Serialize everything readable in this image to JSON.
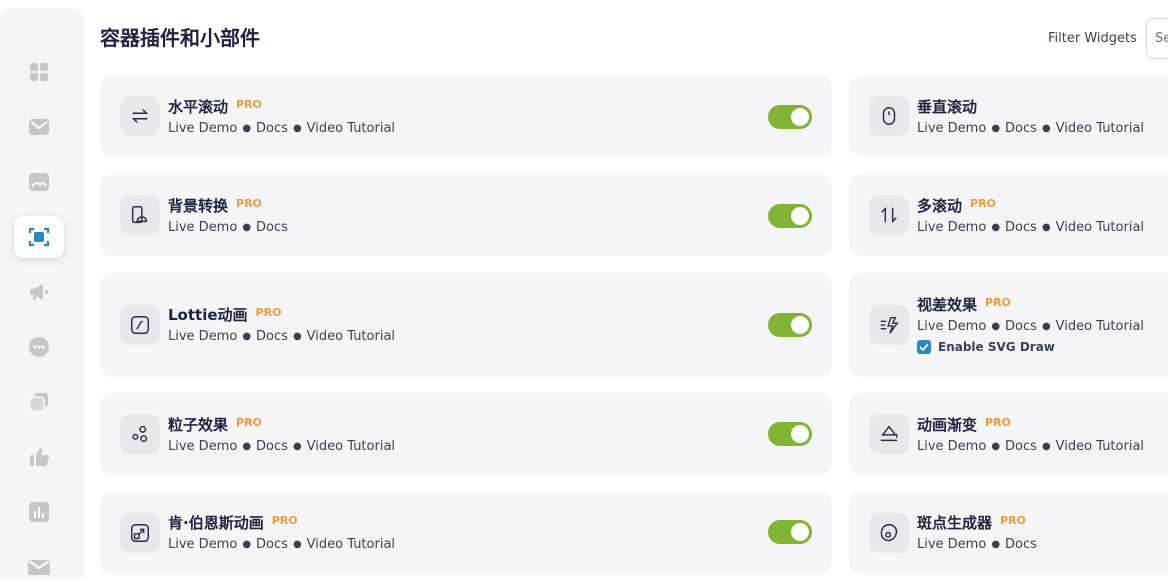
{
  "header": {
    "title": "容器插件和小部件",
    "filter_label": "Filter Widgets",
    "search_placeholder": "Search"
  },
  "sidebar": {
    "items": [
      {
        "icon": "grid-icon"
      },
      {
        "icon": "mail-icon"
      },
      {
        "icon": "image-icon"
      },
      {
        "icon": "scan-icon",
        "active": true
      },
      {
        "icon": "megaphone-icon"
      },
      {
        "icon": "chat-icon"
      },
      {
        "icon": "layers-icon"
      },
      {
        "icon": "thumbs-up-icon"
      },
      {
        "icon": "bar-chart-icon"
      },
      {
        "icon": "envelope-icon"
      }
    ]
  },
  "widgets_left": [
    {
      "name": "水平滚动",
      "pro": "PRO",
      "live": "Live Demo",
      "docs": "Docs",
      "video": "Video Tutorial",
      "icon": "horizontal-scroll-icon"
    },
    {
      "name": "背景转换",
      "pro": "PRO",
      "live": "Live Demo",
      "docs": "Docs",
      "icon": "background-switch-icon"
    },
    {
      "name": "Lottie动画",
      "pro": "PRO",
      "live": "Live Demo",
      "docs": "Docs",
      "video": "Video Tutorial",
      "icon": "lottie-icon"
    },
    {
      "name": "粒子效果",
      "pro": "PRO",
      "live": "Live Demo",
      "docs": "Docs",
      "video": "Video Tutorial",
      "icon": "particles-icon"
    },
    {
      "name": "肯·伯恩斯动画",
      "pro": "PRO",
      "live": "Live Demo",
      "docs": "Docs",
      "video": "Video Tutorial",
      "icon": "ken-burns-icon"
    }
  ],
  "widgets_right": [
    {
      "name": "垂直滚动",
      "live": "Live Demo",
      "docs": "Docs",
      "video": "Video Tutorial",
      "icon": "mouse-icon"
    },
    {
      "name": "多滚动",
      "pro": "PRO",
      "live": "Live Demo",
      "docs": "Docs",
      "video": "Video Tutorial",
      "icon": "multi-scroll-icon"
    },
    {
      "name": "视差效果",
      "pro": "PRO",
      "live": "Live Demo",
      "docs": "Docs",
      "video": "Video Tutorial",
      "icon": "parallax-icon",
      "checkbox_label": "Enable SVG Draw"
    },
    {
      "name": "动画渐变",
      "pro": "PRO",
      "live": "Live Demo",
      "docs": "Docs",
      "video": "Video Tutorial",
      "icon": "gradient-icon"
    },
    {
      "name": "斑点生成器",
      "pro": "PRO",
      "live": "Live Demo",
      "docs": "Docs",
      "icon": "blob-icon"
    }
  ],
  "colors": {
    "accent_toggle": "#80b433",
    "pro": "#f2993a",
    "checkbox": "#2b86c5"
  }
}
